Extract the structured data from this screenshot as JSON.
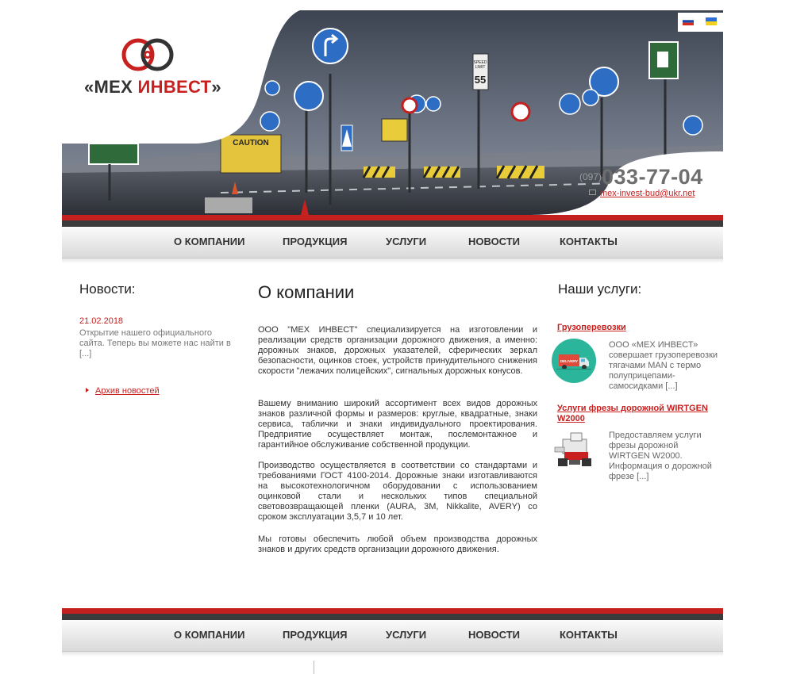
{
  "brand": {
    "name_prefix": "«МЕХ ",
    "name_accent": "ИНВЕСТ",
    "name_suffix": "»"
  },
  "languages": [
    "ru-flag-icon",
    "ua-flag-icon"
  ],
  "contact": {
    "phone_code": "(097)",
    "phone_number": "033-77-04",
    "email": "mex-invest-bud@ukr.net"
  },
  "nav": {
    "items": [
      "О КОМПАНИИ",
      "ПРОДУКЦИЯ",
      "УСЛУГИ",
      "НОВОСТИ",
      "КОНТАКТЫ"
    ]
  },
  "news": {
    "title": "Новости:",
    "date": "21.02.2018",
    "text": "Открытие нашего официального сайта. Теперь вы можете нас найти в [...]",
    "archive_label": "Архив новостей"
  },
  "main": {
    "title": "О компании",
    "paragraphs": [
      "ООО \"МЕХ ИНВЕСТ\" специализируется на изготовлении и реализации средств организации дорожного движения, а именно: дорожных знаков, дорожных указателей, сферических зеркал безопасности, оцинков стоек, устройств принудительного снижения скорости \"лежачих полицейских\", сигнальных дорожных конусов.",
      "Вашему вниманию широкий ассортимент всех видов дорожных знаков различной формы и размеров: круглые, квадратные, знаки сервиса, таблички и знаки индивидуального проектирования. Предприятие осуществляет монтаж, послемонтажное и гарантийное обслуживание собственной продукции.",
      "Производство осуществляется в соответствии со стандартами и требованиями ГОСТ 4100-2014. Дорожные знаки изготавливаются на высокотехнологичном оборудовании с использованием оцинковой стали и нескольких типов специальной световозвращающей пленки (AURA, 3M, Nikkalite, AVERY) со сроком эксплуатации 3,5,7 и 10 лет.",
      "Мы готовы обеспечить любой объем производства дорожных знаков и других средств организации дорожного движения."
    ]
  },
  "services": {
    "title": "Наши услуги:",
    "items": [
      {
        "title": "Грузоперевозки",
        "text": "ООО «МЕХ ИНВЕСТ» совершает грузоперевозки тягачами MAN с термо полуприцепами-самосидками [...]",
        "icon": "delivery-truck-icon",
        "badge": "DELIVERY"
      },
      {
        "title": "Услуги фрезы дорожной WIRTGEN W2000",
        "text": "Предоставляем услуги фрезы дорожной WIRTGEN W2000. Информация о дорожной фрезе [...]",
        "icon": "road-milling-machine-image"
      }
    ]
  },
  "banner": {
    "sign_text_speed": "SPEED LIMIT",
    "sign_number": "55",
    "caution_text": "CAUTION"
  },
  "colors": {
    "accent_red": "#c4201f",
    "dark_band": "#3b3b3b",
    "service_green": "#2bb59a"
  }
}
